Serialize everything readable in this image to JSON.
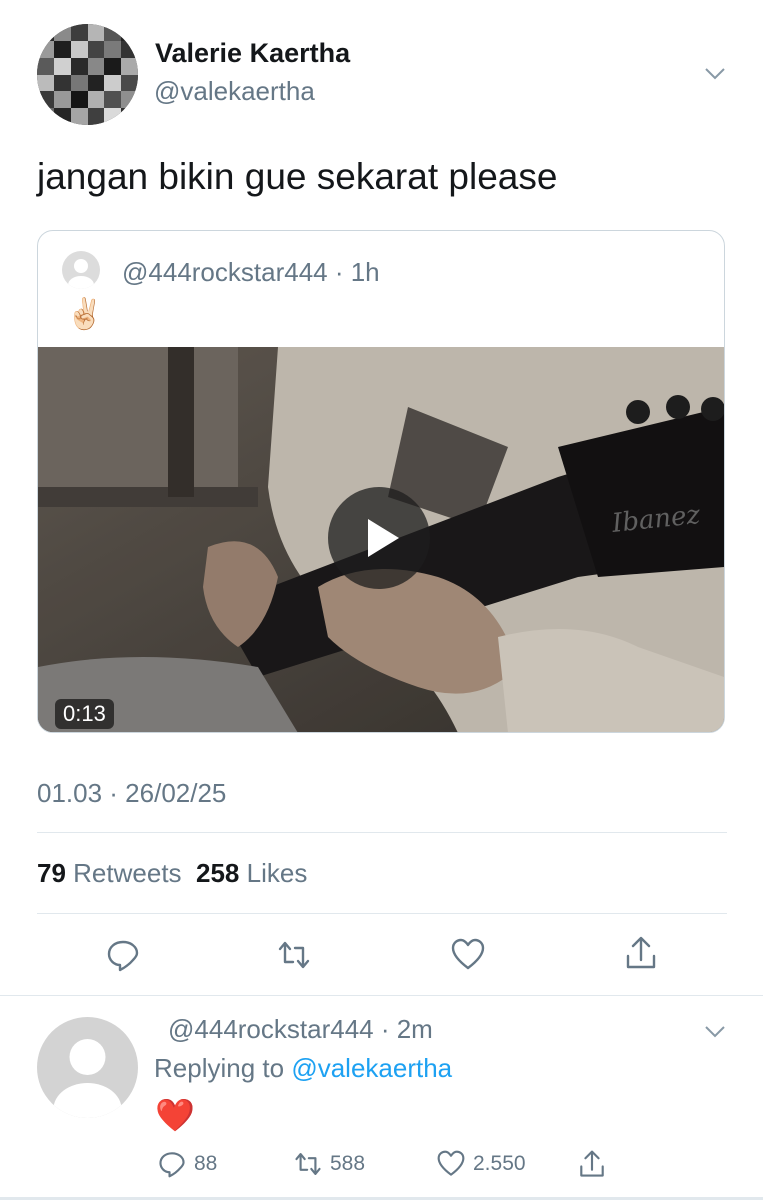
{
  "tweet": {
    "display_name": "Valerie Kaertha",
    "handle": "@valekaertha",
    "text": "jangan bikin gue sekarat please",
    "timestamp": "01.03 · 26/02/25",
    "retweets_count": "79",
    "retweets_label": "Retweets",
    "likes_count": "258",
    "likes_label": "Likes"
  },
  "quote": {
    "header": "@444rockstar444 · 1h",
    "emoji": "✌🏻",
    "video_duration": "0:13",
    "video_brand_text": "Ibanez"
  },
  "reply": {
    "header": "@444rockstar444 · 2m",
    "replying_prefix": "Replying to",
    "replying_to": "@valekaertha",
    "text": "❤️",
    "reply_count": "88",
    "retweet_count": "588",
    "like_count": "2.550"
  },
  "colors": {
    "text_primary": "#14171a",
    "text_secondary": "#657786",
    "link": "#1da1f2",
    "divider": "#e1e8ed",
    "heart": "#e0245e"
  },
  "icons": {
    "more": "chevron-down-icon",
    "reply": "reply-icon",
    "retweet": "retweet-icon",
    "like": "heart-icon",
    "share": "share-icon",
    "play": "play-icon"
  }
}
